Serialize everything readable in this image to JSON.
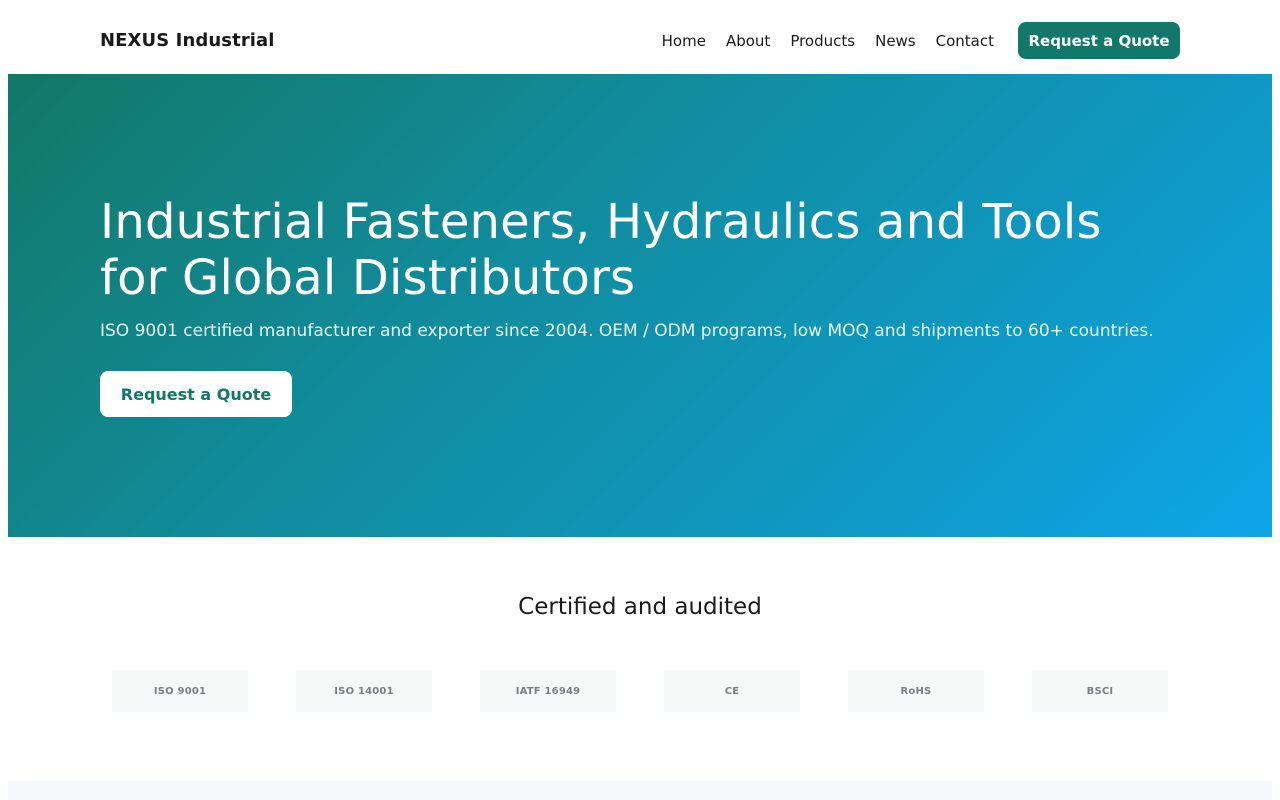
{
  "header": {
    "brand": "NEXUS Industrial",
    "nav": [
      "Home",
      "About",
      "Products",
      "News",
      "Contact"
    ],
    "cta_label": "Request a Quote"
  },
  "hero": {
    "title": "Industrial Fasteners, Hydraulics and Tools for Global Distributors",
    "subtitle": "ISO 9001 certified manufacturer and exporter since 2004. OEM / ODM programs, low MOQ and shipments to 60+ countries.",
    "cta_label": "Request a Quote"
  },
  "certifications": {
    "title": "Certified and audited",
    "badges": [
      "ISO 9001",
      "ISO 14001",
      "IATF 16949",
      "CE",
      "RoHS",
      "BSCI"
    ]
  },
  "colors": {
    "brand_green": "#11786a",
    "hero_gradient_start": "#127867",
    "hero_gradient_end": "#0ea5e9"
  }
}
